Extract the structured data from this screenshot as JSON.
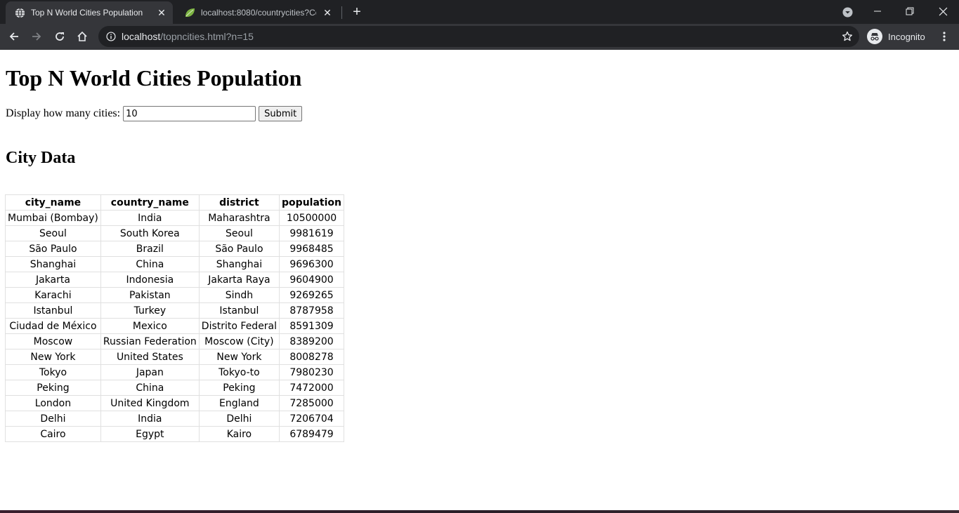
{
  "browser": {
    "tabs": [
      {
        "title": "Top N World Cities Population",
        "active": true
      },
      {
        "title": "localhost:8080/countrycities?Cou",
        "active": false
      }
    ],
    "address": {
      "host": "localhost",
      "path": "/topncities.html?n=15"
    },
    "profile_label": "Incognito"
  },
  "page": {
    "heading": "Top N World Cities Population",
    "form": {
      "label": "Display how many cities:",
      "value": "10",
      "submit_label": "Submit"
    },
    "section_heading": "City Data",
    "table": {
      "headers": [
        "city_name",
        "country_name",
        "district",
        "population"
      ],
      "rows": [
        [
          "Mumbai (Bombay)",
          "India",
          "Maharashtra",
          "10500000"
        ],
        [
          "Seoul",
          "South Korea",
          "Seoul",
          "9981619"
        ],
        [
          "São Paulo",
          "Brazil",
          "São Paulo",
          "9968485"
        ],
        [
          "Shanghai",
          "China",
          "Shanghai",
          "9696300"
        ],
        [
          "Jakarta",
          "Indonesia",
          "Jakarta Raya",
          "9604900"
        ],
        [
          "Karachi",
          "Pakistan",
          "Sindh",
          "9269265"
        ],
        [
          "Istanbul",
          "Turkey",
          "Istanbul",
          "8787958"
        ],
        [
          "Ciudad de México",
          "Mexico",
          "Distrito Federal",
          "8591309"
        ],
        [
          "Moscow",
          "Russian Federation",
          "Moscow (City)",
          "8389200"
        ],
        [
          "New York",
          "United States",
          "New York",
          "8008278"
        ],
        [
          "Tokyo",
          "Japan",
          "Tokyo-to",
          "7980230"
        ],
        [
          "Peking",
          "China",
          "Peking",
          "7472000"
        ],
        [
          "London",
          "United Kingdom",
          "England",
          "7285000"
        ],
        [
          "Delhi",
          "India",
          "Delhi",
          "7206704"
        ],
        [
          "Cairo",
          "Egypt",
          "Kairo",
          "6789479"
        ]
      ]
    }
  }
}
